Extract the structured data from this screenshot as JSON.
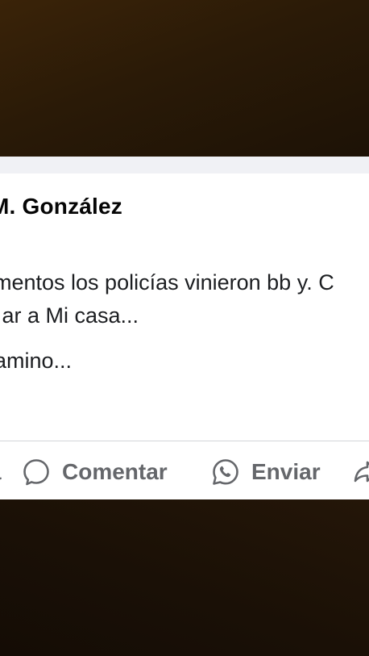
{
  "post": {
    "author": "M. González",
    "text_lines": [
      "mentos los policías vinieron bb y. C",
      "r ar a Mi casa...",
      "amino..."
    ]
  },
  "actions": {
    "like_label": "a",
    "comment_label": "Comentar",
    "send_label": "Enviar"
  },
  "icons": {
    "comment": "comment-bubble-icon",
    "send": "whatsapp-icon",
    "share": "share-arrow-icon"
  },
  "colors": {
    "background": "#1c1208",
    "card": "#ffffff",
    "separator_band": "#f0f1f5",
    "action_text": "#65676b",
    "body_text": "#1c1e21"
  }
}
